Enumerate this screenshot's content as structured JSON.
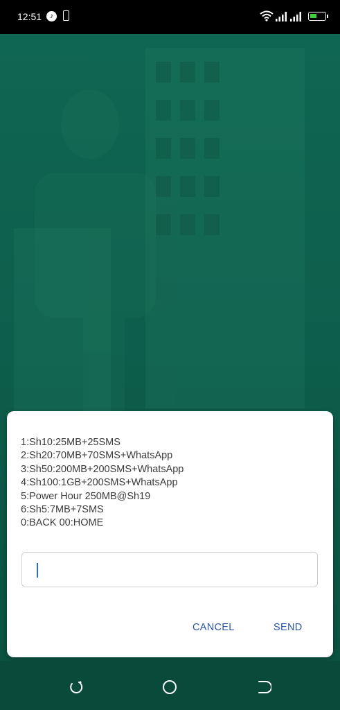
{
  "status_bar": {
    "time": "12:51",
    "icons": [
      "music-icon",
      "phone-icon",
      "wifi-icon",
      "signal-icon",
      "signal-icon",
      "battery-charging-icon"
    ]
  },
  "dialog": {
    "lines": [
      "1:Sh10:25MB+25SMS",
      "2:Sh20:70MB+70SMS+WhatsApp",
      "3:Sh50:200MB+200SMS+WhatsApp",
      "4:Sh100:1GB+200SMS+WhatsApp",
      "5:Power Hour 250MB@Sh19",
      "6:Sh5:7MB+7SMS",
      "0:BACK 00:HOME"
    ],
    "input_value": "",
    "cancel_label": "CANCEL",
    "send_label": "SEND"
  },
  "nav_bar": {
    "icons": [
      "recents-icon",
      "home-icon",
      "back-icon"
    ]
  },
  "colors": {
    "accent": "#2b55a6",
    "background": "#0d5c4a",
    "battery": "#3ed13b"
  }
}
